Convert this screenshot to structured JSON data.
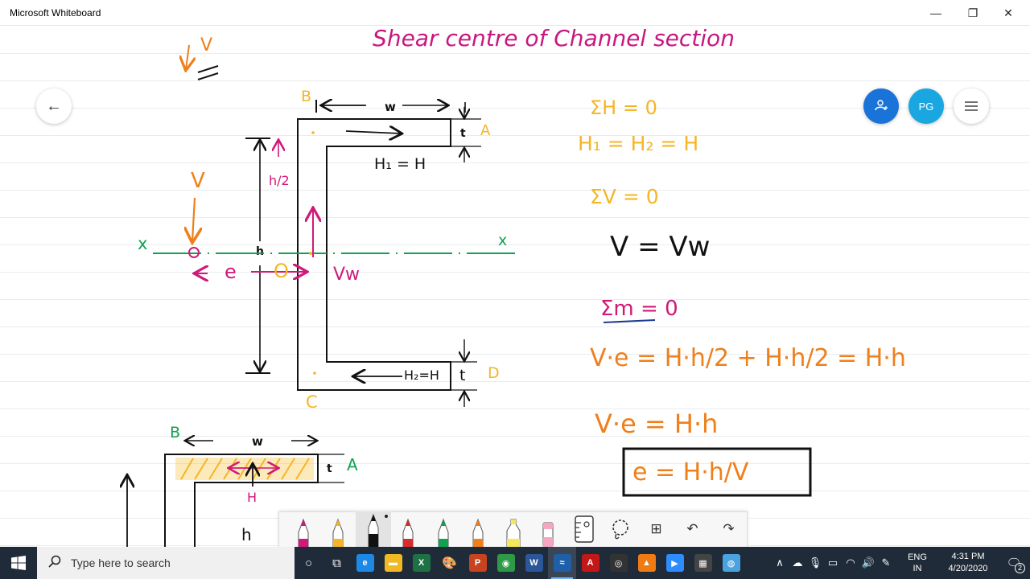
{
  "window": {
    "title": "Microsoft Whiteboard",
    "minimize_glyph": "—",
    "restore_glyph": "❐",
    "close_glyph": "✕"
  },
  "overlay": {
    "back_glyph": "←",
    "invite_glyph": "👤",
    "profile_initials": "PG",
    "menu_glyph": "≡"
  },
  "board": {
    "title": "Shear centre of Channel section",
    "colors": {
      "title": "#c8177f",
      "orange": "#f07f1a",
      "yellow": "#f5b525",
      "magenta": "#d0197a",
      "green": "#12a151",
      "black": "#111111",
      "navy": "#1d3c8f"
    },
    "corner_note": {
      "v": "V"
    },
    "diagram": {
      "points": {
        "b": "B",
        "a": "A",
        "c": "C",
        "d": "D",
        "o": "O"
      },
      "dims": {
        "w": "w",
        "t_top": "t",
        "t_bottom": "t",
        "h": "h",
        "h_half": "h/2"
      },
      "axis": {
        "x_left": "x",
        "x_right": "x"
      },
      "forces": {
        "h1": "H₁ = H",
        "h2": "H₂=H",
        "v": "V",
        "vw": "Vw",
        "e": "e"
      }
    },
    "equations": {
      "sum_h": "ΣH = 0",
      "h1_h2": "H₁ = H₂ = H",
      "sum_v": "ΣV = 0",
      "v_vw": "V = Vw",
      "sum_m": "Σm = 0",
      "moment": "V·e = H·h/2 + H·h/2 = H·h",
      "moment2": "V·e = H·h",
      "result": "e = H·h/V"
    },
    "diagram2": {
      "b": "B",
      "w": "w",
      "t": "t",
      "a": "A",
      "h": "H",
      "hh": "h"
    }
  },
  "pen_toolbar": {
    "tools": [
      {
        "name": "pen-magenta",
        "color": "#d0197a"
      },
      {
        "name": "pen-yellow",
        "color": "#f5b525"
      },
      {
        "name": "pen-black",
        "color": "#111111"
      },
      {
        "name": "pen-red",
        "color": "#d92b2b"
      },
      {
        "name": "pen-green",
        "color": "#12a151"
      },
      {
        "name": "pen-orange",
        "color": "#f07f1a"
      },
      {
        "name": "highlighter-yellow",
        "color": "#f3e85a"
      },
      {
        "name": "eraser",
        "color": "#f4a7c2"
      }
    ],
    "ruler_glyph": "📏",
    "lasso_glyph": "◌",
    "add_glyph": "⊞",
    "undo_glyph": "↶",
    "redo_glyph": "↷"
  },
  "taskbar": {
    "search_placeholder": "Type here to search",
    "apps": [
      {
        "name": "cortana",
        "glyph": "○",
        "color": "transparent"
      },
      {
        "name": "task-view",
        "glyph": "⧉",
        "color": "transparent"
      },
      {
        "name": "edge",
        "glyph": "e",
        "color": "#1e88e5"
      },
      {
        "name": "file-explorer",
        "glyph": "▬",
        "color": "#f2b824"
      },
      {
        "name": "excel",
        "glyph": "X",
        "color": "#1e7145"
      },
      {
        "name": "paint",
        "glyph": "🎨",
        "color": "transparent"
      },
      {
        "name": "powerpoint",
        "glyph": "P",
        "color": "#c8431f"
      },
      {
        "name": "chrome",
        "glyph": "◉",
        "color": "#2e9a48"
      },
      {
        "name": "word",
        "glyph": "W",
        "color": "#2b579a"
      },
      {
        "name": "whiteboard",
        "glyph": "≈",
        "color": "#1f5fa8"
      },
      {
        "name": "acrobat",
        "glyph": "A",
        "color": "#c21818"
      },
      {
        "name": "obs",
        "glyph": "◎",
        "color": "#333333"
      },
      {
        "name": "vlc",
        "glyph": "▲",
        "color": "#ef7b14"
      },
      {
        "name": "zoom",
        "glyph": "▶",
        "color": "#2d8cff"
      },
      {
        "name": "calculator",
        "glyph": "▦",
        "color": "#444444"
      },
      {
        "name": "globe-app",
        "glyph": "◍",
        "color": "#4aa3df"
      }
    ],
    "tray": {
      "chevron": "∧",
      "language_line1": "ENG",
      "language_line2": "IN",
      "time": "4:31 PM",
      "date": "4/20/2020",
      "notifications": "2"
    }
  }
}
